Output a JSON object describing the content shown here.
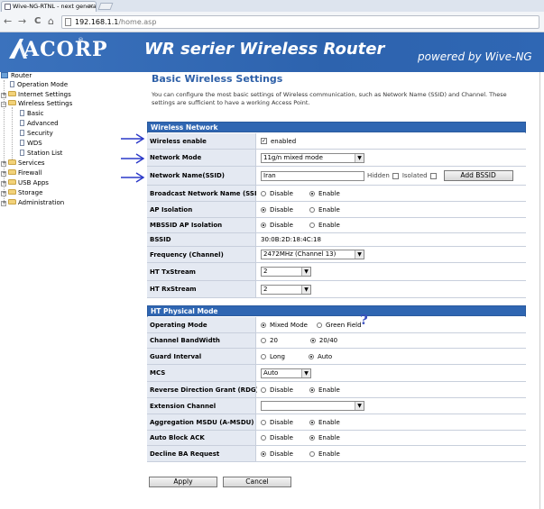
{
  "browser": {
    "tab_title": "Wive-NG-RTNL - next generati",
    "tab_close": "×",
    "back": "←",
    "forward": "→",
    "reload": "C",
    "home": "⌂",
    "url_host": "192.168.1.1",
    "url_path": "/home.asp"
  },
  "banner": {
    "logo": "ACORP",
    "logo_mark": "®",
    "title": "WR serier Wireless Router",
    "subtitle": "powered by Wive-NG"
  },
  "sidebar": {
    "root": "Router",
    "items": [
      {
        "label": "Operation Mode"
      },
      {
        "label": "Internet Settings"
      },
      {
        "label": "Wireless Settings"
      },
      {
        "label": "Basic"
      },
      {
        "label": "Advanced"
      },
      {
        "label": "Security"
      },
      {
        "label": "WDS"
      },
      {
        "label": "Station List"
      },
      {
        "label": "Services"
      },
      {
        "label": "Firewall"
      },
      {
        "label": "USB Apps"
      },
      {
        "label": "Storage"
      },
      {
        "label": "Administration"
      }
    ]
  },
  "main": {
    "title": "Basic Wireless Settings",
    "description": "You can configure the most basic settings of Wireless communication, such as Network Name (SSID) and Channel. These settings are sufficient to have a working Access Point."
  },
  "wireless_network": {
    "header": "Wireless Network",
    "wireless_enable": {
      "label": "Wireless enable",
      "option": "enabled",
      "checked": true
    },
    "network_mode": {
      "label": "Network Mode",
      "value": "11g/n mixed mode"
    },
    "ssid": {
      "label": "Network Name(SSID)",
      "value": "Iran",
      "hidden_label": "Hidden",
      "isolated_label": "Isolated",
      "add_button": "Add BSSID"
    },
    "broadcast": {
      "label": "Broadcast Network Name (SSID)",
      "options": [
        "Disable",
        "Enable"
      ],
      "selected": "Enable"
    },
    "ap_isolation": {
      "label": "AP Isolation",
      "options": [
        "Disable",
        "Enable"
      ],
      "selected": "Disable"
    },
    "mbssid_isolation": {
      "label": "MBSSID AP Isolation",
      "options": [
        "Disable",
        "Enable"
      ],
      "selected": "Disable"
    },
    "bssid": {
      "label": "BSSID",
      "value": "30:0B:2D:18:4C:18"
    },
    "frequency": {
      "label": "Frequency (Channel)",
      "value": "2472MHz (Channel 13)"
    },
    "ht_tx": {
      "label": "HT TxStream",
      "value": "2"
    },
    "ht_rx": {
      "label": "HT RxStream",
      "value": "2"
    }
  },
  "ht_physical": {
    "header": "HT Physical Mode",
    "operating_mode": {
      "label": "Operating Mode",
      "options": [
        "Mixed Mode",
        "Green Field"
      ],
      "selected": "Mixed Mode"
    },
    "bandwidth": {
      "label": "Channel BandWidth",
      "options": [
        "20",
        "20/40"
      ],
      "selected": "20/40"
    },
    "guard_interval": {
      "label": "Guard Interval",
      "options": [
        "Long",
        "Auto"
      ],
      "selected": "Auto"
    },
    "mcs": {
      "label": "MCS",
      "value": "Auto"
    },
    "rdg": {
      "label": "Reverse Direction Grant (RDG)",
      "options": [
        "Disable",
        "Enable"
      ],
      "selected": "Enable"
    },
    "extension_channel": {
      "label": "Extension Channel",
      "value": ""
    },
    "amsdu": {
      "label": "Aggregation MSDU (A-MSDU)",
      "options": [
        "Disable",
        "Enable"
      ],
      "selected": "Enable"
    },
    "auto_block_ack": {
      "label": "Auto Block ACK",
      "options": [
        "Disable",
        "Enable"
      ],
      "selected": "Enable"
    },
    "decline_ba": {
      "label": "Decline BA Request",
      "options": [
        "Disable",
        "Enable"
      ],
      "selected": "Disable"
    }
  },
  "annotation": {
    "question_mark": "?",
    "arrow_color": "#2a38c8"
  },
  "buttons": {
    "apply": "Apply",
    "cancel": "Cancel"
  }
}
